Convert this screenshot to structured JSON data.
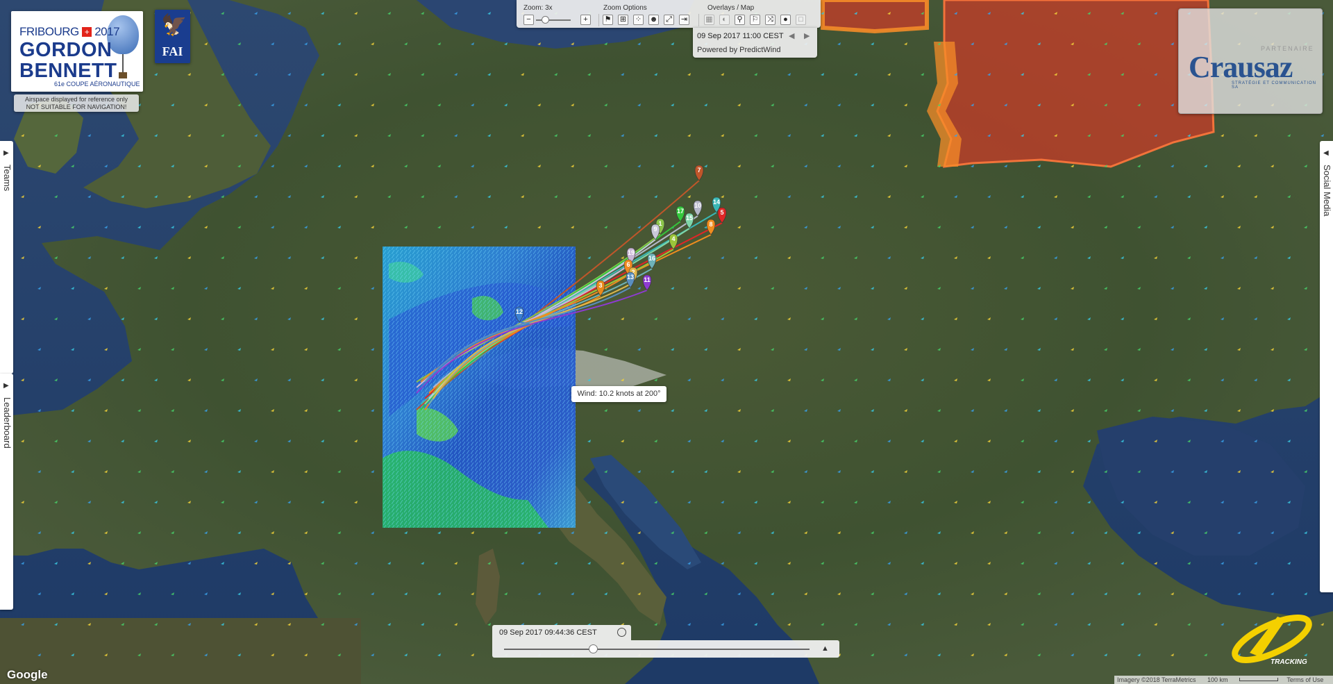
{
  "event_logo": {
    "line1": "FRIBOURG",
    "swiss_cross": "+",
    "year": "2017",
    "line2": "GORDON",
    "line3": "BENNETT",
    "line4": "61e COUPE AÉRONAUTIQUE"
  },
  "fai_logo": {
    "text": "FAI",
    "icon": "eagle-icon"
  },
  "airspace_note": {
    "line1": "Airspace displayed for reference only",
    "line2": "NOT SUITABLE FOR NAVIGATION!"
  },
  "controls": {
    "zoom_label": "Zoom: 3x",
    "zoom_options_label": "Zoom Options",
    "overlays_label": "Overlays / Map",
    "zoom_out": "−",
    "zoom_in": "+",
    "zoom_option_icons": [
      "flag-icon",
      "plus-box-icon",
      "grid-dots-icon",
      "group-icon",
      "fullscreen-icon",
      "exit-icon"
    ],
    "overlay_icons": [
      "grid-overlay-icon",
      "half-circle-icon",
      "wind-barb-icon",
      "wind-flag-icon",
      "shuffle-icon",
      "globe-icon",
      "square-icon"
    ]
  },
  "wind_panel": {
    "datetime": "09 Sep 2017 11:00 CEST",
    "prev": "◀",
    "next": "▶",
    "powered_by": "Powered by PredictWind"
  },
  "partner_logo": {
    "small": "PARTENAIRE",
    "name": "Crausaz",
    "tagline": "STRATÉGIE ET COMMUNICATION SA"
  },
  "side_tabs": {
    "teams": "Teams",
    "leaderboard": "Leaderboard",
    "social": "Social Media",
    "arrow_left": "▶",
    "arrow_right": "◀"
  },
  "wind_tooltip": "Wind: 10.2 knots at 200°",
  "timeline": {
    "datetime": "09 Sep 2017 09:44:36 CEST",
    "position": 0.29,
    "play_icon": "▲"
  },
  "tracking_logo": "TRACKING",
  "google": "Google",
  "attribution": {
    "imagery": "Imagery ©2018 TerraMetrics",
    "scale": "100 km",
    "terms": "Terms of Use"
  },
  "balloons": [
    {
      "id": "7",
      "color": "#c0562a"
    },
    {
      "id": "14",
      "color": "#39b7b5"
    },
    {
      "id": "5",
      "color": "#e02626"
    },
    {
      "id": "8",
      "color": "#f08d1e"
    },
    {
      "id": "10",
      "color": "#b5b8c9"
    },
    {
      "id": "1",
      "color": "#8bc34a"
    },
    {
      "id": "17",
      "color": "#34c83c"
    },
    {
      "id": "15",
      "color": "#7fd6a8"
    },
    {
      "id": "9",
      "color": "#c8c8d8"
    },
    {
      "id": "4",
      "color": "#9bc43a"
    },
    {
      "id": "19",
      "color": "#c9b6d6"
    },
    {
      "id": "6",
      "color": "#ef8a22"
    },
    {
      "id": "3",
      "color": "#e98a1c"
    },
    {
      "id": "16",
      "color": "#6fb2b8"
    },
    {
      "id": "2",
      "color": "#e2b84a"
    },
    {
      "id": "11",
      "color": "#8e3bd1"
    },
    {
      "id": "12",
      "color": "#3a7fd0"
    },
    {
      "id": "13",
      "color": "#5a8fc0"
    }
  ]
}
